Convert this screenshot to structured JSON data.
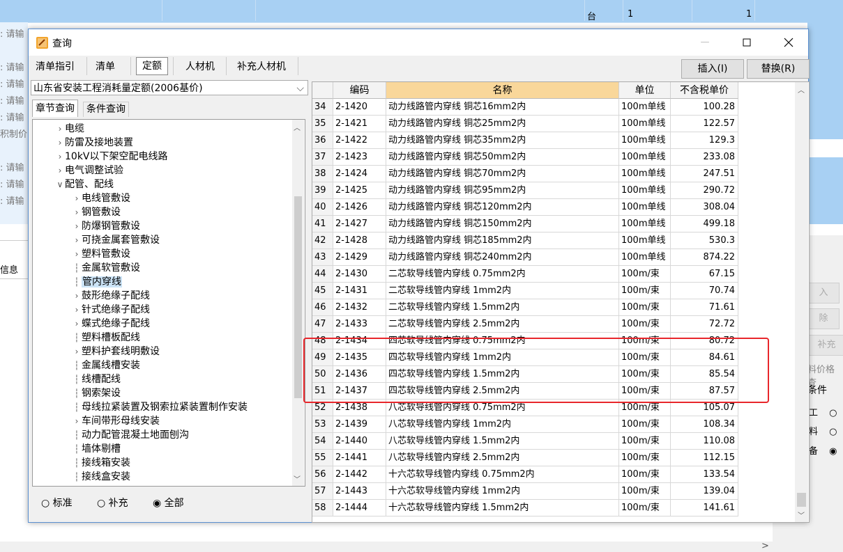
{
  "background": {
    "row1": [
      "台",
      "1",
      "1"
    ],
    "left_labels": [
      ": 请输",
      "",
      ": 请输",
      ": 请输",
      ": 请输",
      ": 请输",
      "积制价",
      "",
      ": 请输",
      ": 请输",
      ": 请输"
    ],
    "info_label": "信息",
    "right_buttons": [
      "入",
      "除",
      "补充"
    ],
    "right_link": "料价格查",
    "condition_label": "条件",
    "condition_options": [
      "工",
      "料",
      "备"
    ],
    "scroll_arrow": ">"
  },
  "dialog": {
    "title": "查询",
    "tabs": [
      "清单指引",
      "清单",
      "定额",
      "人材机",
      "补充人材机"
    ],
    "active_tab": "定额",
    "insert_button": "插入(I)",
    "replace_button": "替换(R)",
    "quota_library": "山东省安装工程消耗量定额(2006基价)",
    "sub_tabs": [
      "章节查询",
      "条件查询"
    ],
    "tree": [
      {
        "label": "电缆",
        "level": 1,
        "arrow": "collapsed"
      },
      {
        "label": "防雷及接地装置",
        "level": 1,
        "arrow": "collapsed"
      },
      {
        "label": "10kV以下架空配电线路",
        "level": 1,
        "arrow": "collapsed"
      },
      {
        "label": "电气调整试验",
        "level": 1,
        "arrow": "collapsed"
      },
      {
        "label": "配管、配线",
        "level": 1,
        "arrow": "expanded"
      },
      {
        "label": "电线管敷设",
        "level": 2,
        "arrow": "collapsed"
      },
      {
        "label": "钢管敷设",
        "level": 2,
        "arrow": "collapsed"
      },
      {
        "label": "防爆钢管敷设",
        "level": 2,
        "arrow": "collapsed"
      },
      {
        "label": "可挠金属套管敷设",
        "level": 2,
        "arrow": "collapsed"
      },
      {
        "label": "塑料管敷设",
        "level": 2,
        "arrow": "collapsed"
      },
      {
        "label": "金属软管敷设",
        "level": 2,
        "arrow": "none"
      },
      {
        "label": "管内穿线",
        "level": 2,
        "arrow": "none",
        "selected": true
      },
      {
        "label": "鼓形绝缘子配线",
        "level": 2,
        "arrow": "collapsed"
      },
      {
        "label": "针式绝缘子配线",
        "level": 2,
        "arrow": "collapsed"
      },
      {
        "label": "蝶式绝缘子配线",
        "level": 2,
        "arrow": "collapsed"
      },
      {
        "label": "塑料槽板配线",
        "level": 2,
        "arrow": "none"
      },
      {
        "label": "塑料护套线明敷设",
        "level": 2,
        "arrow": "collapsed"
      },
      {
        "label": "金属线槽安装",
        "level": 2,
        "arrow": "none"
      },
      {
        "label": "线槽配线",
        "level": 2,
        "arrow": "none"
      },
      {
        "label": "钢索架设",
        "level": 2,
        "arrow": "none"
      },
      {
        "label": "母线拉紧装置及钢索拉紧装置制作安装",
        "level": 2,
        "arrow": "none"
      },
      {
        "label": "车间带形母线安装",
        "level": 2,
        "arrow": "collapsed"
      },
      {
        "label": "动力配管混凝土地面刨沟",
        "level": 2,
        "arrow": "none"
      },
      {
        "label": "墙体剔槽",
        "level": 2,
        "arrow": "none"
      },
      {
        "label": "接线箱安装",
        "level": 2,
        "arrow": "none"
      },
      {
        "label": "接线盒安装",
        "level": 2,
        "arrow": "none"
      }
    ],
    "filter_options": [
      "标准",
      "补充",
      "全部"
    ],
    "filter_selected": "全部",
    "columns": [
      "",
      "编码",
      "名称",
      "单位",
      "不含税单价"
    ],
    "rows": [
      [
        "34",
        "2-1420",
        "动力线路管内穿线 铜芯16mm2内",
        "100m单线",
        "100.28"
      ],
      [
        "35",
        "2-1421",
        "动力线路管内穿线 铜芯25mm2内",
        "100m单线",
        "122.57"
      ],
      [
        "36",
        "2-1422",
        "动力线路管内穿线 铜芯35mm2内",
        "100m单线",
        "129.3"
      ],
      [
        "37",
        "2-1423",
        "动力线路管内穿线 铜芯50mm2内",
        "100m单线",
        "233.08"
      ],
      [
        "38",
        "2-1424",
        "动力线路管内穿线 铜芯70mm2内",
        "100m单线",
        "247.51"
      ],
      [
        "39",
        "2-1425",
        "动力线路管内穿线 铜芯95mm2内",
        "100m单线",
        "290.72"
      ],
      [
        "40",
        "2-1426",
        "动力线路管内穿线 铜芯120mm2内",
        "100m单线",
        "308.04"
      ],
      [
        "41",
        "2-1427",
        "动力线路管内穿线 铜芯150mm2内",
        "100m单线",
        "499.18"
      ],
      [
        "42",
        "2-1428",
        "动力线路管内穿线 铜芯185mm2内",
        "100m单线",
        "530.3"
      ],
      [
        "43",
        "2-1429",
        "动力线路管内穿线 铜芯240mm2内",
        "100m单线",
        "874.22"
      ],
      [
        "44",
        "2-1430",
        "二芯软导线管内穿线 0.75mm2内",
        "100m/束",
        "67.15"
      ],
      [
        "45",
        "2-1431",
        "二芯软导线管内穿线 1mm2内",
        "100m/束",
        "70.74"
      ],
      [
        "46",
        "2-1432",
        "二芯软导线管内穿线 1.5mm2内",
        "100m/束",
        "71.61"
      ],
      [
        "47",
        "2-1433",
        "二芯软导线管内穿线 2.5mm2内",
        "100m/束",
        "72.72"
      ],
      [
        "48",
        "2-1434",
        "四芯软导线管内穿线 0.75mm2内",
        "100m/束",
        "80.72"
      ],
      [
        "49",
        "2-1435",
        "四芯软导线管内穿线 1mm2内",
        "100m/束",
        "84.61"
      ],
      [
        "50",
        "2-1436",
        "四芯软导线管内穿线 1.5mm2内",
        "100m/束",
        "85.54"
      ],
      [
        "51",
        "2-1437",
        "四芯软导线管内穿线 2.5mm2内",
        "100m/束",
        "87.57"
      ],
      [
        "52",
        "2-1438",
        "八芯软导线管内穿线 0.75mm2内",
        "100m/束",
        "105.07"
      ],
      [
        "53",
        "2-1439",
        "八芯软导线管内穿线 1mm2内",
        "100m/束",
        "108.34"
      ],
      [
        "54",
        "2-1440",
        "八芯软导线管内穿线 1.5mm2内",
        "100m/束",
        "110.08"
      ],
      [
        "55",
        "2-1441",
        "八芯软导线管内穿线 2.5mm2内",
        "100m/束",
        "112.15"
      ],
      [
        "56",
        "2-1442",
        "十六芯软导线管内穿线 0.75mm2内",
        "100m/束",
        "133.54"
      ],
      [
        "57",
        "2-1443",
        "十六芯软导线管内穿线 1mm2内",
        "100m/束",
        "139.04"
      ],
      [
        "58",
        "2-1444",
        "十六芯软导线管内穿线 1.5mm2内",
        "100m/束",
        "141.61"
      ]
    ],
    "highlight_rows": [
      "49",
      "50",
      "51"
    ],
    "colors": {
      "name_header_bg": "#f9d79a",
      "highlight_box": "#e8262b",
      "selected_node_bg": "#cce4f7",
      "background_band": "#a8d0f3"
    }
  }
}
